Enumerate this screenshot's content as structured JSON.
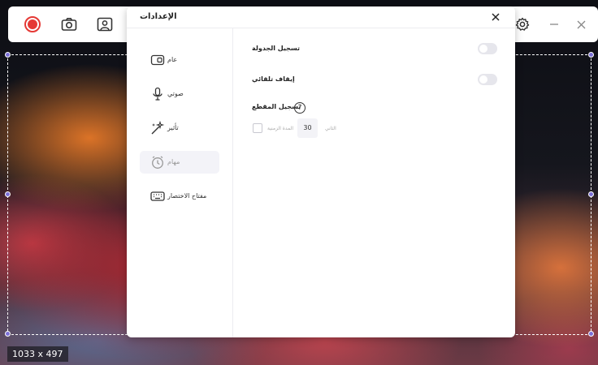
{
  "toolbar": {
    "buttons": [
      "record-icon",
      "camera-icon",
      "webcam-icon",
      "settings-icon",
      "minimize-icon",
      "close-icon"
    ]
  },
  "selection": {
    "dimensions": "1033 x 497"
  },
  "dialog": {
    "title": "الإعدادات",
    "nav": [
      {
        "label": "عام",
        "icon": "video-icon"
      },
      {
        "label": "صوتي",
        "icon": "microphone-icon"
      },
      {
        "label": "تأثير",
        "icon": "magic-wand-icon"
      },
      {
        "label": "مهام",
        "icon": "clock-icon",
        "active": true
      },
      {
        "label": "مفتاح الاختصار",
        "icon": "keyboard-icon"
      }
    ],
    "settings": {
      "schedule_label": "تسجيل الجدولة",
      "schedule_on": false,
      "autostop_label": "إيقاف تلقائي",
      "autostop_on": false,
      "segment_label": "تسجيل المقطع",
      "duration_label": "المدة الزمنية",
      "duration_value": "30",
      "unit_label": "الثاني"
    }
  },
  "colors": {
    "accent": "#7b6fd8",
    "record": "#e53935"
  }
}
